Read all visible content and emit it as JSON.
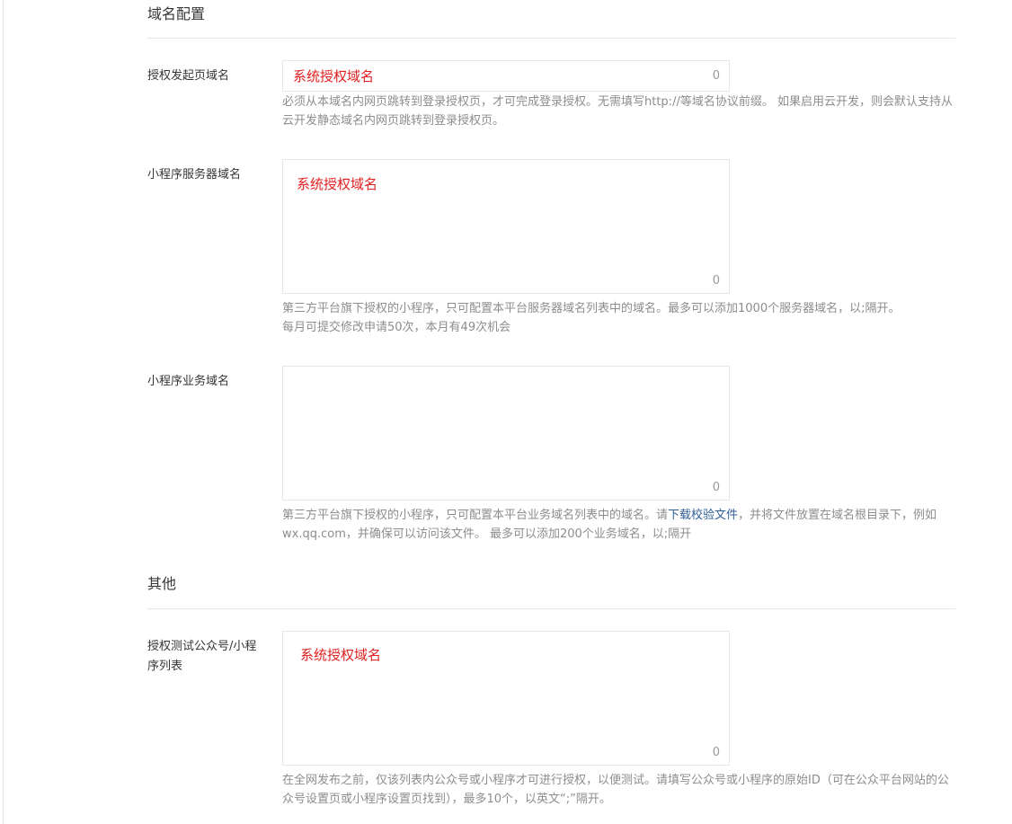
{
  "domain_section": {
    "title": "域名配置"
  },
  "auth_entry_domain": {
    "label": "授权发起页域名",
    "value": "系统授权域名",
    "counter": "0",
    "help": "必须从本域名内网页跳转到登录授权页，才可完成登录授权。无需填写http://等域名协议前缀。 如果启用云开发，则会默认支持从云开发静态域名内网页跳转到登录授权页。"
  },
  "server_domain": {
    "label": "小程序服务器域名",
    "value": "系统授权域名",
    "counter": "0",
    "help_line1": "第三方平台旗下授权的小程序，只可配置本平台服务器域名列表中的域名。最多可以添加1000个服务器域名，以;隔开。",
    "help_line2": "每月可提交修改申请50次，本月有49次机会"
  },
  "business_domain": {
    "label": "小程序业务域名",
    "value": "",
    "counter": "0",
    "help_before": "第三方平台旗下授权的小程序，只可配置本平台业务域名列表中的域名。请",
    "help_link": "下载校验文件",
    "help_after": "，并将文件放置在域名根目录下，例如wx.qq.com，并确保可以访问该文件。 最多可以添加200个业务域名，以;隔开"
  },
  "other_section": {
    "title": "其他"
  },
  "test_accounts": {
    "label": "授权测试公众号/小程序列表",
    "value": "系统授权域名",
    "counter": "0",
    "help": "在全网发布之前，仅该列表内公众号或小程序才可进行授权，以便测试。请填写公众号或小程序的原始ID（可在公众平台网站的公众号设置页或小程序设置页找到），最多10个，以英文“;”隔开。"
  },
  "colors": {
    "value_text": "#e02020",
    "help_text": "#8d8d8d",
    "link": "#2f5d95",
    "border": "#e7e7eb"
  }
}
